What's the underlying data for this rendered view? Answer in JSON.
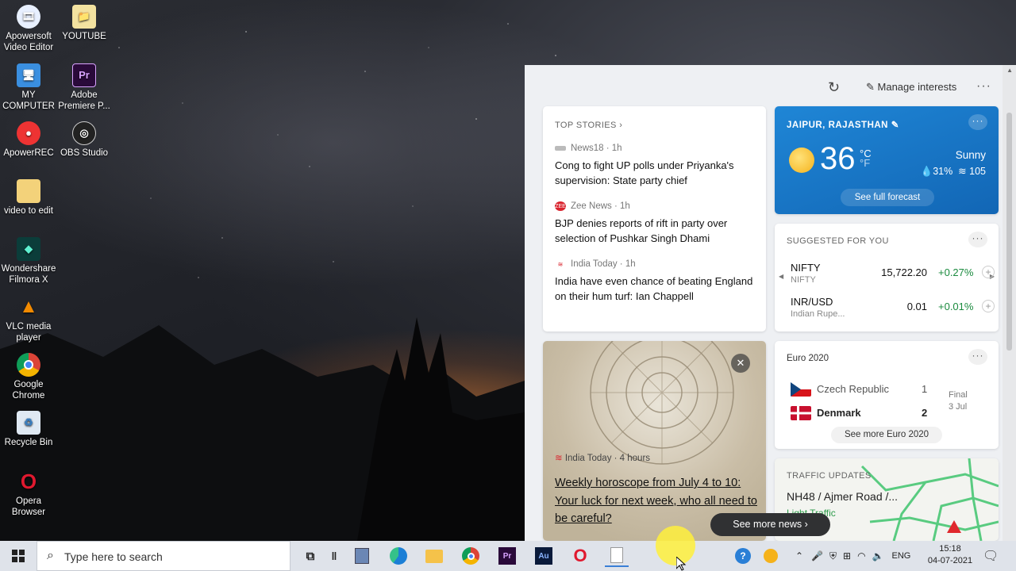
{
  "desktop": {
    "icons": [
      {
        "label": "Apowersoft Video Editor"
      },
      {
        "label": "YOUTUBE"
      },
      {
        "label": "MY COMPUTER"
      },
      {
        "label": "Adobe Premiere P..."
      },
      {
        "label": "ApowerREC"
      },
      {
        "label": "OBS Studio"
      },
      {
        "label": "video to edit"
      },
      {
        "label": "Wondershare Filmora X"
      },
      {
        "label": "VLC media player"
      },
      {
        "label": "Google Chrome"
      },
      {
        "label": "Recycle Bin"
      },
      {
        "label": "Opera Browser"
      }
    ]
  },
  "news_panel": {
    "manage_label": "Manage interests",
    "top_stories": {
      "title": "TOP STORIES",
      "items": [
        {
          "source": "News18 · 1h",
          "headline": "Cong to fight UP polls under Priyanka's supervision: State party chief"
        },
        {
          "source": "Zee News · 1h",
          "headline": "BJP denies reports of rift in party over selection of Pushkar Singh Dhami"
        },
        {
          "source": "India Today · 1h",
          "headline": "India have even chance of beating England on their hum turf: Ian Chappell"
        }
      ]
    },
    "weather": {
      "location": "JAIPUR, RAJASTHAN",
      "temperature": "36",
      "unit_c": "°C",
      "unit_f": "°F",
      "condition": "Sunny",
      "humidity": "31%",
      "aqi": "105",
      "forecast_label": "See full forecast"
    },
    "stocks": {
      "title": "SUGGESTED FOR YOU",
      "rows": [
        {
          "symbol": "NIFTY",
          "name": "NIFTY",
          "price": "15,722.20",
          "change": "+0.27%"
        },
        {
          "symbol": "INR/USD",
          "name": "Indian Rupe...",
          "price": "0.01",
          "change": "+0.01%"
        }
      ]
    },
    "horoscope": {
      "source": "India Today · 4 hours",
      "headline": "Weekly horoscope from July 4 to 10: Your luck for next week, who all need to be careful?"
    },
    "euro": {
      "title": "Euro 2020",
      "team1": {
        "name": "Czech Republic",
        "score": "1"
      },
      "team2": {
        "name": "Denmark",
        "score": "2"
      },
      "status": "Final",
      "date": "3 Jul",
      "more_label": "See more Euro 2020"
    },
    "traffic": {
      "title": "TRAFFIC UPDATES",
      "road": "NH48 / Ajmer Road /...",
      "status": "Light Traffic"
    },
    "see_more_label": "See more news"
  },
  "taskbar": {
    "search_placeholder": "Type here to search",
    "apps": [
      "task-view",
      "widgets",
      "edge",
      "file-explorer",
      "chrome",
      "premiere",
      "audition",
      "opera",
      "notepad"
    ],
    "language": "ENG",
    "time": "15:18",
    "date": "04-07-2021"
  },
  "colors": {
    "weather_bg": "#1a78c8",
    "positive": "#1a8a3e",
    "taskbar": "#dfe3ea"
  }
}
